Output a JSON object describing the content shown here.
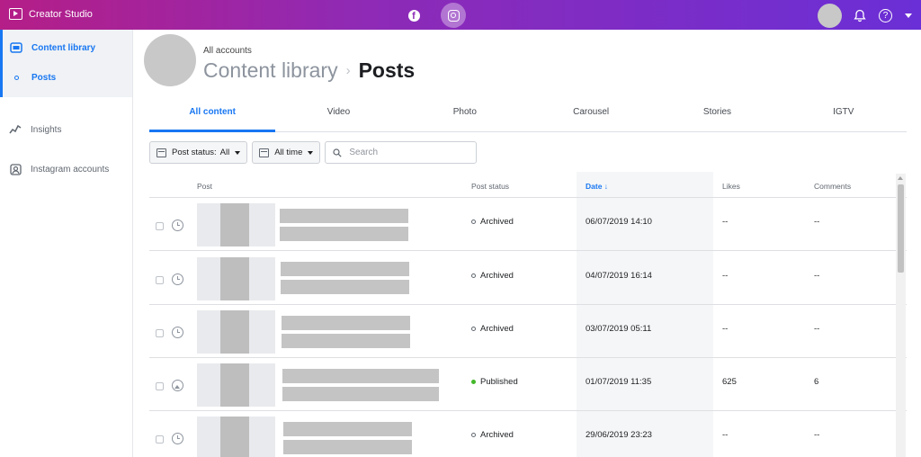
{
  "topbar": {
    "app_name": "Creator Studio",
    "facebook_glyph": "f",
    "help_glyph": "?",
    "icons": [
      "creator-studio-icon",
      "facebook-icon",
      "instagram-icon",
      "bell-icon",
      "help-icon",
      "caret-down-icon"
    ],
    "gradient_colors": [
      "#b51e87",
      "#8e2ab6",
      "#6a2fd6"
    ]
  },
  "sidebar": {
    "items": [
      {
        "label": "Content library",
        "icon": "content-library-icon",
        "active": true
      },
      {
        "label": "Posts",
        "icon": "ring-dot-icon",
        "active": true
      },
      {
        "label": "Insights",
        "icon": "insights-icon",
        "active": false
      },
      {
        "label": "Instagram accounts",
        "icon": "instagram-accounts-icon",
        "active": false
      }
    ]
  },
  "header": {
    "account_label": "All accounts",
    "breadcrumb_parent": "Content library",
    "breadcrumb_separator": "›",
    "breadcrumb_current": "Posts"
  },
  "tabs": [
    {
      "label": "All content",
      "active": true
    },
    {
      "label": "Video",
      "active": false
    },
    {
      "label": "Photo",
      "active": false
    },
    {
      "label": "Carousel",
      "active": false
    },
    {
      "label": "Stories",
      "active": false
    },
    {
      "label": "IGTV",
      "active": false
    }
  ],
  "filters": {
    "post_status_label": "Post status:",
    "post_status_value": "All",
    "time_value": "All time",
    "search_placeholder": "Search"
  },
  "table": {
    "columns": {
      "post": "Post",
      "post_status": "Post status",
      "date": "Date ↓",
      "likes": "Likes",
      "comments": "Comments"
    },
    "rows": [
      {
        "type_icon": "clock-icon",
        "status": "Archived",
        "date": "06/07/2019 14:10",
        "likes": "--",
        "comments": "--"
      },
      {
        "type_icon": "clock-icon",
        "status": "Archived",
        "date": "04/07/2019 16:14",
        "likes": "--",
        "comments": "--"
      },
      {
        "type_icon": "clock-icon",
        "status": "Archived",
        "date": "03/07/2019 05:11",
        "likes": "--",
        "comments": "--"
      },
      {
        "type_icon": "photo-icon",
        "status": "Published",
        "date": "01/07/2019 11:35",
        "likes": "625",
        "comments": "6"
      },
      {
        "type_icon": "clock-icon",
        "status": "Archived",
        "date": "29/06/2019 23:23",
        "likes": "--",
        "comments": "--"
      }
    ]
  },
  "colors": {
    "accent": "#1877f2",
    "published": "#42b72a",
    "archived": "#606770"
  }
}
